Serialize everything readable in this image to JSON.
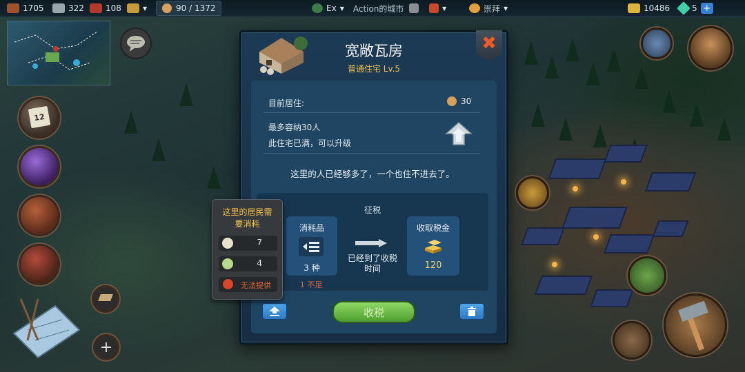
{
  "topbar": {
    "wood": "1705",
    "stone": "322",
    "ore": "108",
    "population": "90 / 1372",
    "player_tag": "Ex",
    "city_name": "Action的城市",
    "religion": "崇拜",
    "gold": "10486",
    "gems": "5",
    "add_label": "+"
  },
  "calendar": {
    "day": "12"
  },
  "dialog": {
    "title": "宽敞瓦房",
    "subtitle": "普通住宅 Lv.5",
    "current_label": "目前居住:",
    "current_value": "30",
    "capacity_prefix": "最多容纳",
    "capacity_value": "30",
    "capacity_suffix": "人",
    "full_note": "此住宅已满，可以升级",
    "notice": "这里的人已经够多了，一个也住不进去了。",
    "tax_title": "征税",
    "consumables_label": "消耗品",
    "consumables_count": "3 种",
    "consumables_short": "1 不足",
    "tax_status": "已经到了收税时间",
    "tax_collect_label": "收取税金",
    "tax_amount": "120",
    "collect_button": "收税",
    "close_symbol": "✖"
  },
  "tooltip": {
    "title": "这里的居民需要消耗",
    "items": [
      {
        "icon": "rice-icon",
        "value": "7"
      },
      {
        "icon": "cabbage-icon",
        "value": "4"
      },
      {
        "icon": "apple-icon",
        "value": "无法提供"
      }
    ]
  },
  "colors": {
    "title_gold": "#f0c24a",
    "shortage_red": "#e2643a",
    "collect_green": "#6fbf45",
    "accent_blue": "#3a7fd1"
  }
}
